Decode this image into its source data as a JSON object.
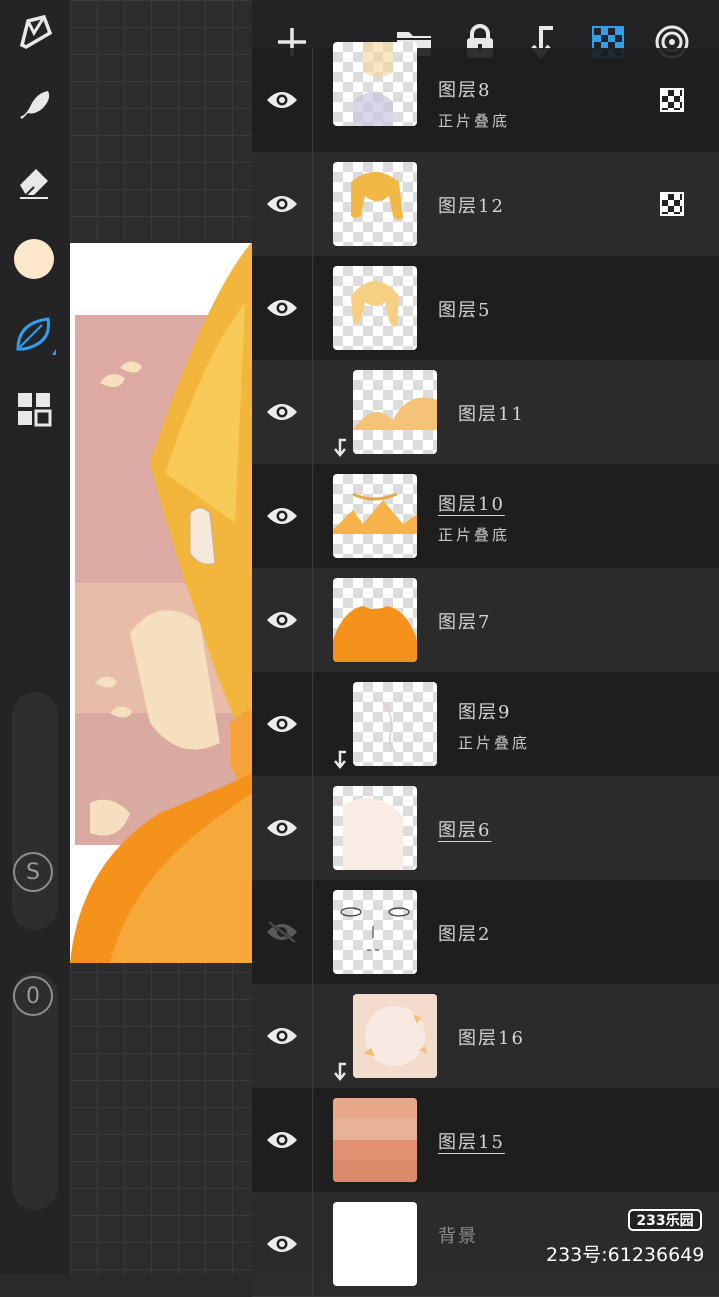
{
  "toolbar": {
    "tools": [
      "brush-tool",
      "smudge-tool",
      "eraser-tool",
      "color-swatch",
      "leaf-brush-tool",
      "gallery-grid"
    ],
    "current_color": "#fde8cc",
    "active_color": "#2f9ff0",
    "opacity_label": "S",
    "size_label": "0"
  },
  "panel": {
    "top_buttons": [
      "add-layer",
      "folder",
      "lock",
      "merge-down",
      "transparency",
      "reference"
    ],
    "accent": "#2f9ff0",
    "layers": [
      {
        "name": "图层8",
        "blend": "正片叠底",
        "visible": true,
        "clipped": false,
        "underline": false,
        "alpha_lock": true
      },
      {
        "name": "图层12",
        "blend": "",
        "visible": true,
        "clipped": false,
        "underline": false,
        "alpha_lock": true
      },
      {
        "name": "图层5",
        "blend": "",
        "visible": true,
        "clipped": false,
        "underline": false,
        "alpha_lock": false
      },
      {
        "name": "图层11",
        "blend": "",
        "visible": true,
        "clipped": true,
        "underline": false,
        "alpha_lock": false
      },
      {
        "name": "图层10",
        "blend": "正片叠底",
        "visible": true,
        "clipped": false,
        "underline": true,
        "alpha_lock": false
      },
      {
        "name": "图层7",
        "blend": "",
        "visible": true,
        "clipped": false,
        "underline": false,
        "alpha_lock": false
      },
      {
        "name": "图层9",
        "blend": "正片叠底",
        "visible": true,
        "clipped": true,
        "underline": false,
        "alpha_lock": false
      },
      {
        "name": "图层6",
        "blend": "",
        "visible": true,
        "clipped": false,
        "underline": true,
        "alpha_lock": false
      },
      {
        "name": "图层2",
        "blend": "",
        "visible": false,
        "clipped": false,
        "underline": false,
        "alpha_lock": false
      },
      {
        "name": "图层16",
        "blend": "",
        "visible": true,
        "clipped": true,
        "underline": false,
        "alpha_lock": false
      },
      {
        "name": "图层15",
        "blend": "",
        "visible": true,
        "clipped": false,
        "underline": true,
        "alpha_lock": false
      },
      {
        "name": "背景",
        "blend": "",
        "visible": true,
        "clipped": false,
        "underline": false,
        "alpha_lock": false
      }
    ]
  },
  "watermark": {
    "logo": "233乐园",
    "id": "233号:61236649"
  }
}
